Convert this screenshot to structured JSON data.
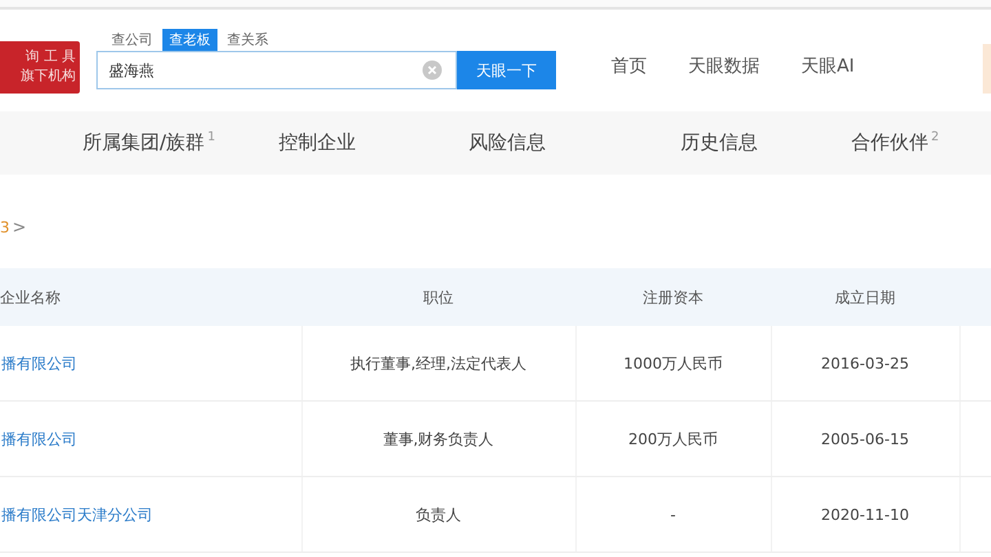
{
  "logo": {
    "lines": [
      "询 工 具",
      "旗下机构"
    ]
  },
  "search": {
    "modes": [
      {
        "label": "查公司",
        "selected": false
      },
      {
        "label": "查老板",
        "selected": true
      },
      {
        "label": "查关系",
        "selected": false
      }
    ],
    "value": "盛海燕",
    "button": "天眼一下"
  },
  "nav": [
    "首页",
    "天眼数据",
    "天眼AI"
  ],
  "tabs": [
    {
      "label": "所属集团/族群",
      "count": "1"
    },
    {
      "label": "控制企业"
    },
    {
      "label": "风险信息"
    },
    {
      "label": "历史信息"
    },
    {
      "label": "合作伙伴",
      "count": "2"
    }
  ],
  "section": {
    "count": "3",
    "chevron": ">"
  },
  "table": {
    "columns": [
      "企业名称",
      "职位",
      "注册资本",
      "成立日期"
    ],
    "rows": [
      [
        "播有限公司",
        "执行董事,经理,法定代表人",
        "1000万人民币",
        "2016-03-25"
      ],
      [
        "播有限公司",
        "董事,财务负责人",
        "200万人民币",
        "2005-06-15"
      ],
      [
        "播有限公司天津分公司",
        "负责人",
        "-",
        "2020-11-10"
      ]
    ]
  }
}
